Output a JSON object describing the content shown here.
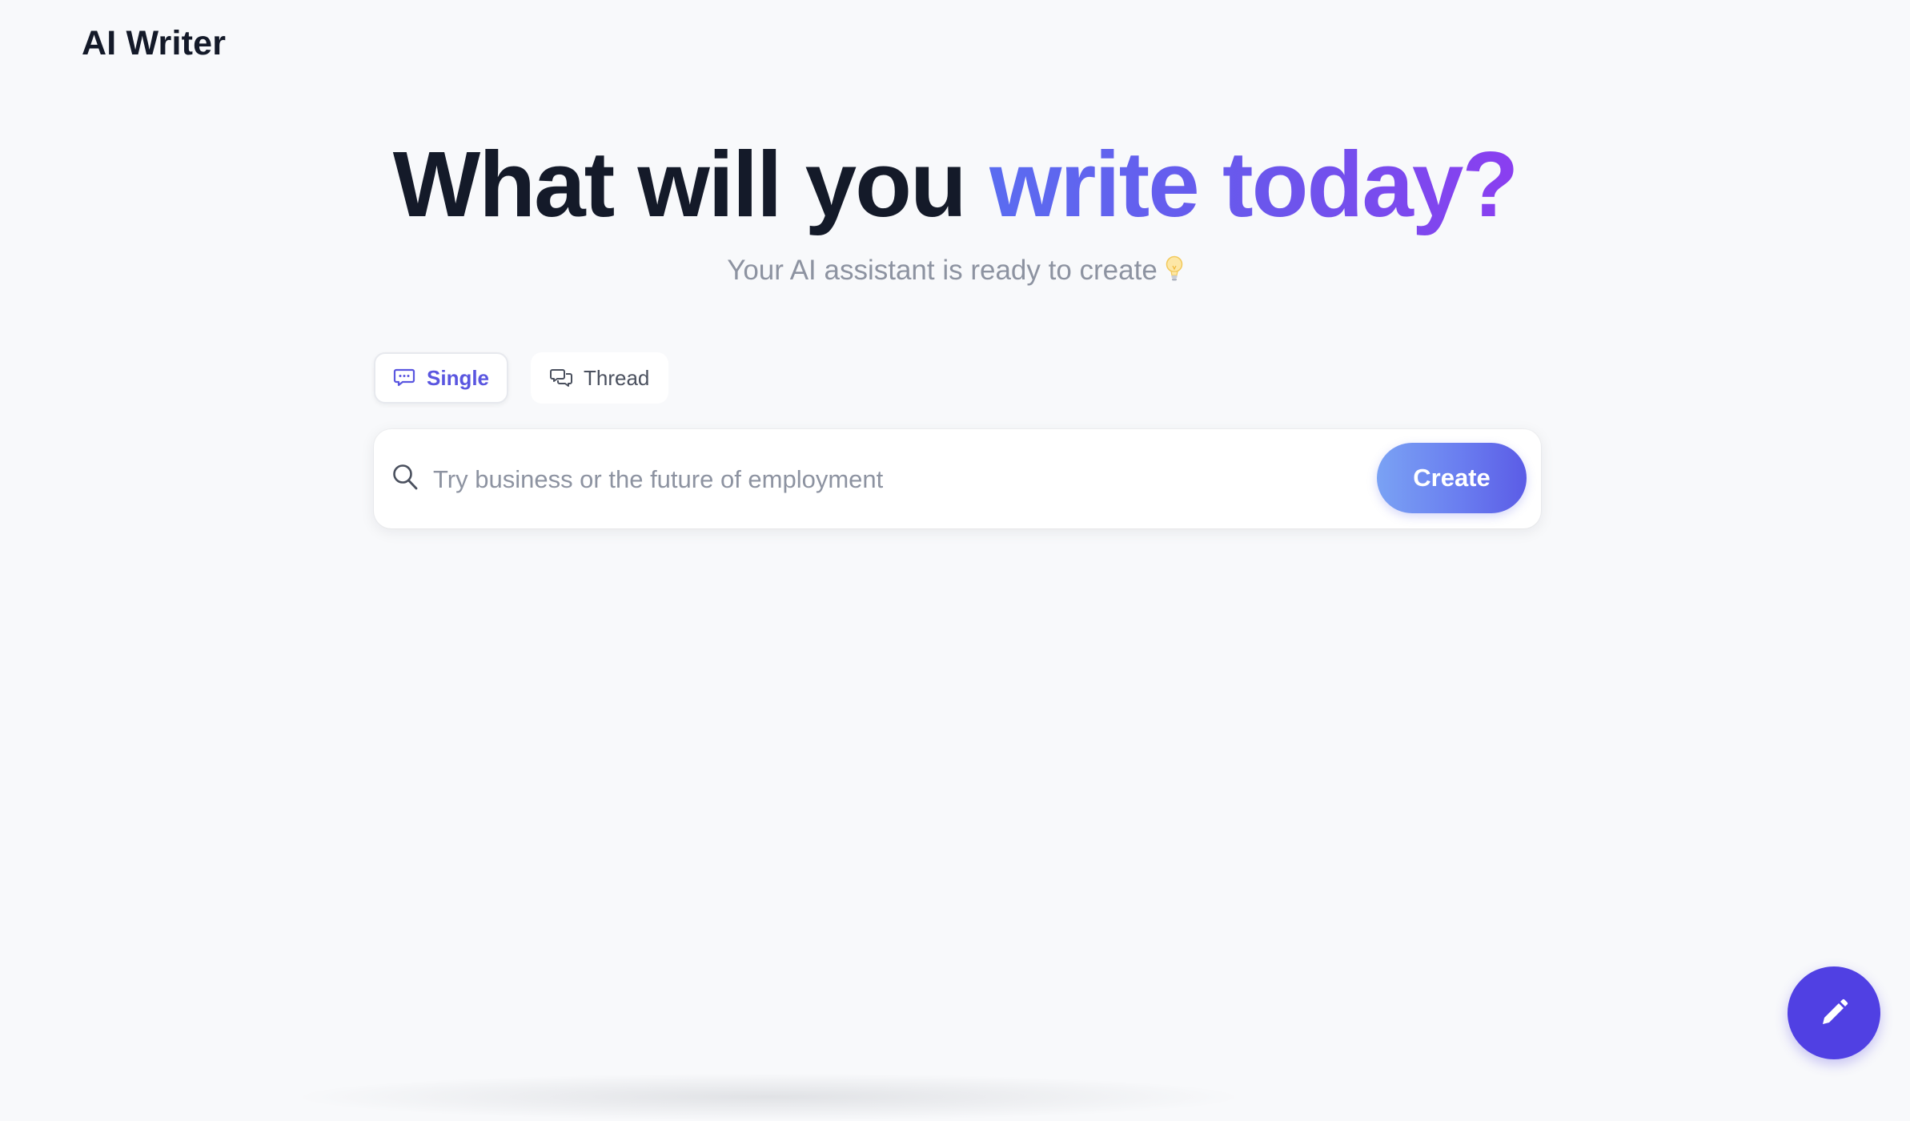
{
  "header": {
    "brand": "AI Writer"
  },
  "hero": {
    "title_plain": "What will you ",
    "title_accent": "write today?",
    "subtitle": "Your AI assistant is ready to create",
    "subtitle_icon": "lightbulb-icon"
  },
  "mode_tabs": [
    {
      "label": "Single",
      "icon": "speech-bubble-icon",
      "active": true
    },
    {
      "label": "Thread",
      "icon": "chat-bubbles-icon",
      "active": false
    }
  ],
  "search": {
    "placeholder": "Try business or the future of employment",
    "value": "",
    "icon": "search-icon"
  },
  "actions": {
    "create_label": "Create",
    "fab_icon": "pencil-icon"
  },
  "colors": {
    "background": "#f8f9fb",
    "text_primary": "#141a29",
    "text_muted": "#8d93a1",
    "accent_start": "#5a6cf0",
    "accent_end": "#8b3ef0",
    "active_tab": "#5a56e0",
    "fab": "#5040e3"
  }
}
